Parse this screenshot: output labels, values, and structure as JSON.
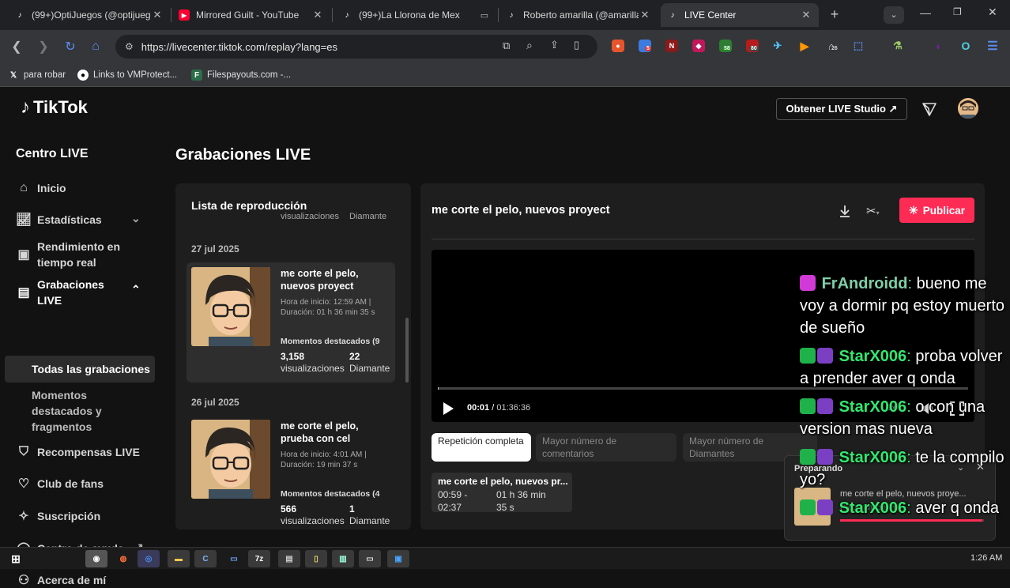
{
  "browser": {
    "tabs": [
      {
        "label": "(99+)OptiJuegos (@optijuego",
        "icon": "tiktok-icon",
        "active": false
      },
      {
        "label": "Mirrored Guilt - YouTube",
        "icon": "youtube-icon",
        "active": false
      },
      {
        "label": "(99+)La Llorona de Mex",
        "icon": "tiktok-icon",
        "active": false
      },
      {
        "label": "Roberto amarilla (@amarilla",
        "icon": "tiktok-icon",
        "active": false
      },
      {
        "label": "LIVE Center",
        "icon": "tiktok-icon",
        "active": true
      }
    ],
    "url": "https://livecenter.tiktok.com/replay?lang=es",
    "extension_badges": {
      "e1": "5",
      "e2": "58",
      "e3": "80",
      "e4": "26"
    },
    "bookmarks": [
      {
        "label": "para robar",
        "icon": "x-icon"
      },
      {
        "label": "Links to VMProtect...",
        "icon": "github-icon"
      },
      {
        "label": "Filespayouts.com -...",
        "icon": "filespayouts-icon"
      }
    ]
  },
  "header": {
    "logo": "TikTok",
    "studio_button": "Obtener LIVE Studio ↗"
  },
  "sidebar": {
    "title": "Centro LIVE",
    "items": [
      {
        "label": "Inicio",
        "icon": "home-icon"
      },
      {
        "label": "Estadísticas",
        "icon": "chart-icon"
      },
      {
        "label": "Rendimiento en tiempo real",
        "icon": "monitor-icon"
      },
      {
        "label": "Grabaciones LIVE",
        "icon": "recordings-icon"
      },
      {
        "label": "Recompensas LIVE",
        "icon": "reward-icon"
      },
      {
        "label": "Club de fans",
        "icon": "heart-icon"
      },
      {
        "label": "Suscripción",
        "icon": "subscription-icon"
      },
      {
        "label": "Centro de ayuda",
        "icon": "help-icon"
      },
      {
        "label": "Acerca de mí",
        "icon": "user-icon"
      }
    ],
    "sub_items": [
      "Todas las grabaciones",
      "Momentos destacados y fragmentos"
    ]
  },
  "main": {
    "title": "Grabaciones LIVE",
    "playlist": {
      "title": "Lista de reproducción",
      "trunc_prev_views": "visualizaciones",
      "trunc_prev_diamonds": "Diamante",
      "groups": [
        {
          "date": "27 jul 2025",
          "title": "me corte el pelo, nuevos proyect",
          "meta": "Hora de inicio: 12:59 AM | Duración: 01 h 36 min 35 s",
          "moments": "Momentos destacados (9",
          "views": "3,158",
          "views_label": "visualizaciones",
          "diamonds": "22",
          "diamonds_label": "Diamante"
        },
        {
          "date": "26 jul 2025",
          "title": "me corte el pelo, prueba con cel",
          "meta": "Hora de inicio: 4:01 AM | Duración: 19 min 37 s",
          "moments": "Momentos destacados (4",
          "views": "566",
          "views_label": "visualizaciones",
          "diamonds": "1",
          "diamonds_label": "Diamante"
        }
      ]
    },
    "player": {
      "title": "me corte el pelo, nuevos proyect",
      "publish": "Publicar",
      "current_time": "00:01",
      "total_time": "01:36:36",
      "speed": "1x",
      "progress": 0.0002,
      "tabs": [
        "Repetición completa",
        "Mayor número de comentarios",
        "Mayor número de Diamantes"
      ],
      "moment": {
        "title": "me corte el pelo, nuevos pr...",
        "range_start": "00:59 -",
        "range_end": "02:37",
        "dur1": "01 h 36 min",
        "dur2": "35 s"
      }
    },
    "mini_popup": {
      "title": "Preparando",
      "name": "me corte el pelo, nuevos proye...",
      "status": "Preparando 99%",
      "progress": 0.99
    }
  },
  "chat": [
    {
      "user": "FrAndroidd",
      "text": "bueno me voy a dormir pq estoy muerto de sueño",
      "color": "#7fcfa8"
    },
    {
      "user": "StarX006",
      "text": "proba volver a prender aver q onda",
      "color": "#32e86e"
    },
    {
      "user": "StarX006",
      "text": "o con una version mas nueva",
      "color": "#32e86e"
    },
    {
      "user": "StarX006",
      "text": "te la compilo yo?",
      "color": "#32e86e"
    },
    {
      "user": "StarX006",
      "text": "aver q onda",
      "color": "#32e86e"
    }
  ],
  "taskbar": {
    "clock": "1:26 AM"
  },
  "colors": {
    "accent": "#fe2c55",
    "bg": "#121212",
    "panel": "#1e1e1e"
  }
}
